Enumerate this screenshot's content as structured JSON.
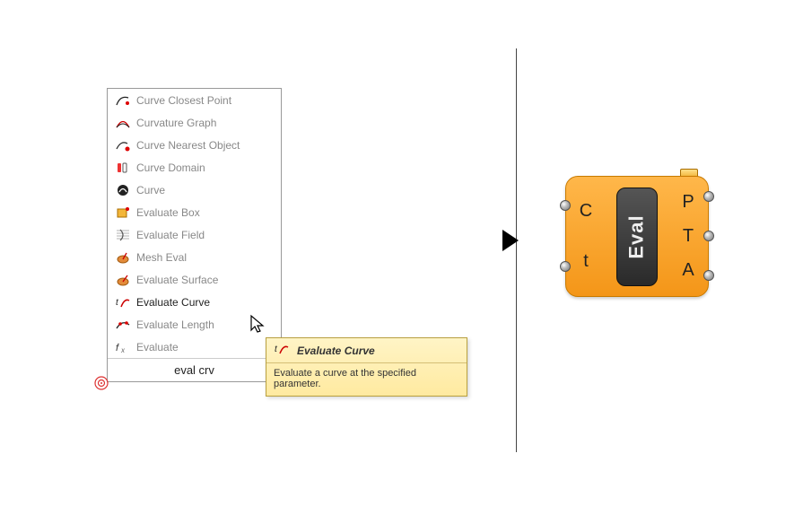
{
  "popup": {
    "items": [
      {
        "label": "Curve Closest Point",
        "icon": "curve-closest-point-icon"
      },
      {
        "label": "Curvature Graph",
        "icon": "curvature-graph-icon"
      },
      {
        "label": "Curve Nearest Object",
        "icon": "curve-nearest-object-icon"
      },
      {
        "label": "Curve Domain",
        "icon": "curve-domain-icon"
      },
      {
        "label": "Curve",
        "icon": "curve-icon"
      },
      {
        "label": "Evaluate Box",
        "icon": "evaluate-box-icon"
      },
      {
        "label": "Evaluate Field",
        "icon": "evaluate-field-icon"
      },
      {
        "label": "Mesh Eval",
        "icon": "mesh-eval-icon"
      },
      {
        "label": "Evaluate Surface",
        "icon": "evaluate-surface-icon"
      },
      {
        "label": "Evaluate Curve",
        "icon": "evaluate-curve-icon"
      },
      {
        "label": "Evaluate Length",
        "icon": "evaluate-length-icon"
      },
      {
        "label": "Evaluate",
        "icon": "evaluate-icon"
      }
    ],
    "selected_index": 9,
    "search_value": "eval crv"
  },
  "tooltip": {
    "title": "Evaluate Curve",
    "description": "Evaluate a curve at the specified parameter."
  },
  "component": {
    "name": "Eval",
    "inputs": [
      "C",
      "t"
    ],
    "outputs": [
      "P",
      "T",
      "A"
    ]
  }
}
